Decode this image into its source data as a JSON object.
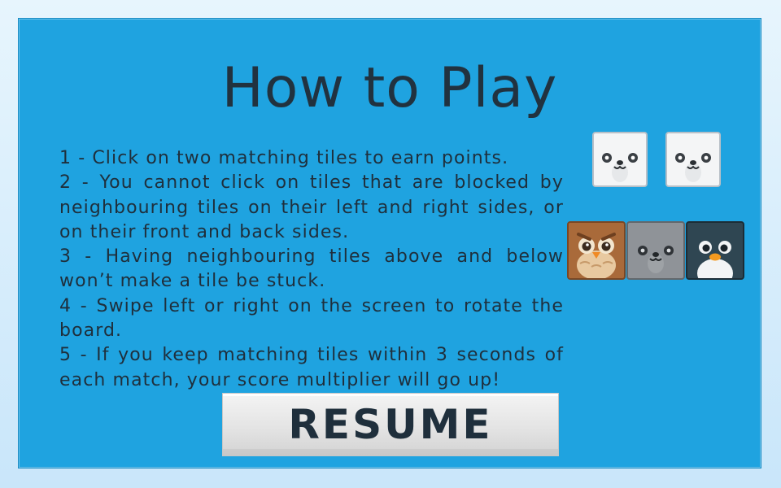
{
  "dialog": {
    "title": "How to Play",
    "instructions": [
      "1 - Click on two matching tiles to earn points.",
      "2 - You cannot click on tiles that are blocked by neighbouring tiles on their left and right sides, or on their front and back sides.",
      "3 - Having neighbouring tiles above and below won’t make a tile be stuck.",
      "4 - Swipe left or right on the screen to rotate the board.",
      "5 - If you keep matching tiles within 3 seconds of each match, your score multiplier will go up!"
    ],
    "resume_label": "RESUME"
  },
  "tiles": {
    "matching_pair": [
      "panda-tile-icon",
      "panda-tile-icon"
    ],
    "blocked_row": [
      "owl-tile-icon",
      "koala-tile-icon",
      "penguin-tile-icon"
    ]
  },
  "colors": {
    "panel_background": "#1fa3e0",
    "text": "#1f2f3c",
    "button_background": "#e4e4e4"
  }
}
